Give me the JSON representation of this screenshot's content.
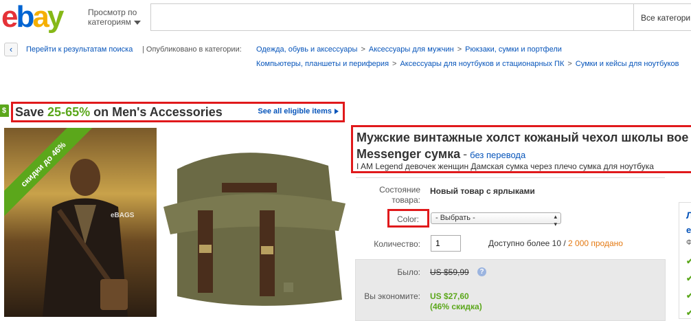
{
  "header": {
    "logo": {
      "e": "e",
      "b": "b",
      "a": "a",
      "y": "y"
    },
    "browse_label_line1": "Просмотр по",
    "browse_label_line2": "категориям",
    "search_value": "",
    "category_select": "Все категори"
  },
  "breadcrumbs": {
    "back_label": "Перейти к результатам поиска",
    "separator": "| Опубликовано в категории:",
    "row1": [
      "Одежда, обувь и аксессуары",
      "Аксессуары для мужчин",
      "Рюкзаки, сумки и портфели"
    ],
    "row2": [
      "Компьютеры, планшеты и периферия",
      "Аксессуары для ноутбуков и стационарных ПК",
      "Сумки и кейсы для ноутбуков"
    ],
    "gt": ">"
  },
  "promo": {
    "tag": "$",
    "prefix": "Save ",
    "highlight": "25-65%",
    "suffix": " on Men's Accessories",
    "link": "See all eligible items"
  },
  "image": {
    "ribbon": "скидки до 46%",
    "watermark": "eBAGS"
  },
  "title": {
    "line1": "Мужские винтажные холст кожаный чехол школы вое",
    "line2": "Messenger сумка",
    "dash": "-",
    "translation_link": "без перевода",
    "subtitle": "I AM Legend девочек женщин Дамская сумка через плечо сумка для ноутбука"
  },
  "details": {
    "condition_label_1": "Состояние",
    "condition_label_2": "товара:",
    "condition_value": "Новый товар с ярлыками",
    "color_label": "Color:",
    "color_select": "- Выбрать -",
    "quantity_label": "Количество:",
    "quantity_value": "1",
    "availability": "Доступно более 10 / ",
    "sold": "2 000 продано"
  },
  "price": {
    "was_label": "Было:",
    "was_value": "US $59,99",
    "help": "?",
    "save_label": "Вы экономите:",
    "save_value": "US $27,60",
    "save_percent": "(46% скидка)"
  },
  "side": {
    "t1": "Л",
    "t2": "е",
    "t3": "Ф",
    "check": "✔"
  }
}
